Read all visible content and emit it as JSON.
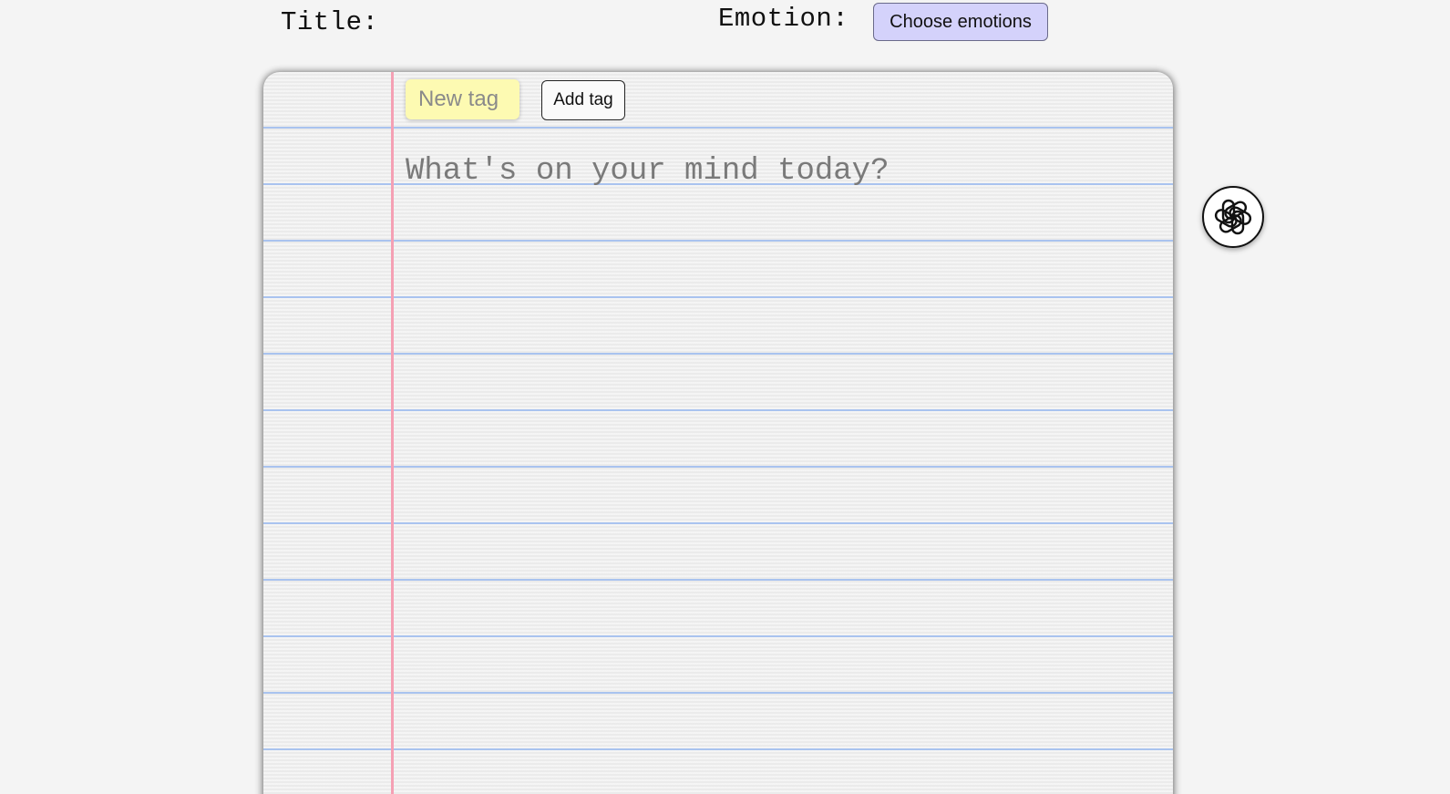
{
  "header": {
    "title_label": "Title:",
    "emotion_label": "Emotion:",
    "choose_emotions_label": "Choose emotions"
  },
  "notepad": {
    "new_tag_placeholder": "New tag",
    "add_tag_label": "Add tag",
    "entry_placeholder": "What's on your mind today?"
  },
  "ai_button": {
    "icon": "openai-logo-icon"
  },
  "colors": {
    "background": "#f4f4f4",
    "paper": "#efefef",
    "rule_lines": "#a9c3ef",
    "margin_line": "#f5a0b4",
    "tag_note": "#fdfab2",
    "emotion_button": "#d4d2fb"
  }
}
